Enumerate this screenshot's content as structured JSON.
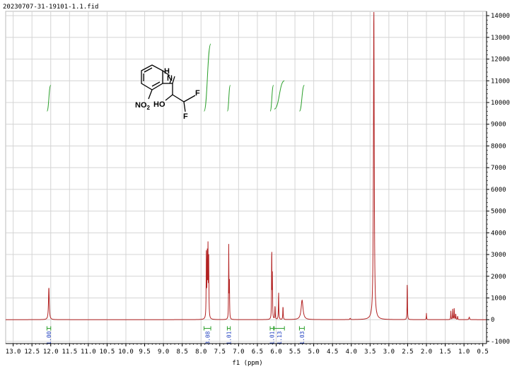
{
  "chart_data": {
    "type": "line",
    "title": "20230707-31-19101-1.1.fid",
    "xlabel": "f1 (ppm)",
    "ylabel": "",
    "xlim": [
      13.2,
      0.4
    ],
    "ylim": [
      -1100,
      14200
    ],
    "x_ticks": [
      "13.0",
      "12.5",
      "12.0",
      "11.5",
      "11.0",
      "10.5",
      "10.0",
      "9.5",
      "9.0",
      "8.5",
      "8.0",
      "7.5",
      "7.0",
      "6.5",
      "6.0",
      "5.5",
      "5.0",
      "4.5",
      "4.0",
      "3.5",
      "3.0",
      "2.5",
      "2.0",
      "1.5",
      "1.0",
      "0.5"
    ],
    "y_ticks": [
      "14000",
      "13000",
      "12000",
      "11000",
      "10000",
      "9000",
      "8000",
      "7000",
      "6000",
      "5000",
      "4000",
      "3000",
      "2000",
      "1000",
      "0",
      "-1000"
    ],
    "grid": true,
    "colors": {
      "spectrum": "#b22222",
      "integral": "#2ca02c",
      "integral_label": "#1f3fbf",
      "grid": "#d4d4d4"
    },
    "peaks": [
      {
        "ppm": 12.05,
        "height": 1500,
        "width": 0.012
      },
      {
        "ppm": 7.858,
        "height": 2950,
        "width": 0.006
      },
      {
        "ppm": 7.835,
        "height": 2850,
        "width": 0.006
      },
      {
        "ppm": 7.815,
        "height": 3150,
        "width": 0.006
      },
      {
        "ppm": 7.795,
        "height": 2700,
        "width": 0.006
      },
      {
        "ppm": 7.262,
        "height": 3450,
        "width": 0.005
      },
      {
        "ppm": 7.244,
        "height": 1700,
        "width": 0.005
      },
      {
        "ppm": 6.118,
        "height": 3550,
        "width": 0.005
      },
      {
        "ppm": 6.1,
        "height": 2000,
        "width": 0.005
      },
      {
        "ppm": 6.03,
        "height": 650,
        "width": 0.006
      },
      {
        "ppm": 5.935,
        "height": 1300,
        "width": 0.006
      },
      {
        "ppm": 5.818,
        "height": 650,
        "width": 0.006
      },
      {
        "ppm": 5.31,
        "height": 900,
        "width": 0.03
      },
      {
        "ppm": 4.03,
        "height": 60,
        "width": 0.01
      },
      {
        "ppm": 3.4,
        "height": 14500,
        "width": 0.012
      },
      {
        "ppm": 2.51,
        "height": 1850,
        "width": 0.005
      },
      {
        "ppm": 2.0,
        "height": 300,
        "width": 0.005
      },
      {
        "ppm": 1.35,
        "height": 400,
        "width": 0.005
      },
      {
        "ppm": 1.3,
        "height": 500,
        "width": 0.005
      },
      {
        "ppm": 1.26,
        "height": 560,
        "width": 0.005
      },
      {
        "ppm": 1.22,
        "height": 300,
        "width": 0.005
      },
      {
        "ppm": 1.17,
        "height": 180,
        "width": 0.005
      },
      {
        "ppm": 0.86,
        "height": 120,
        "width": 0.01
      }
    ],
    "integrals": [
      {
        "ppm_start": 12.1,
        "ppm_end": 12.0,
        "value": "1.00",
        "y_start": 9600,
        "y_end": 10800
      },
      {
        "ppm_start": 7.92,
        "ppm_end": 7.74,
        "value": "3.08",
        "y_start": 9600,
        "y_end": 12700
      },
      {
        "ppm_start": 7.3,
        "ppm_end": 7.22,
        "value": "1.01",
        "y_start": 9600,
        "y_end": 10800
      },
      {
        "ppm_start": 6.16,
        "ppm_end": 6.07,
        "value": "1.01",
        "y_start": 9600,
        "y_end": 10800
      },
      {
        "ppm_start": 6.05,
        "ppm_end": 5.78,
        "value": "1.13",
        "y_start": 9700,
        "y_end": 11000
      },
      {
        "ppm_start": 5.38,
        "ppm_end": 5.25,
        "value": "1.03",
        "y_start": 9600,
        "y_end": 10800
      }
    ]
  },
  "molecule": {
    "atoms": [
      {
        "label": "H",
        "role": "nh-h"
      },
      {
        "label": "N",
        "role": "nh-n"
      },
      {
        "label": "NO",
        "sub": "2",
        "role": "nitro"
      },
      {
        "label": "HO",
        "role": "hydroxyl"
      },
      {
        "label": "F",
        "role": "fluorine-1"
      },
      {
        "label": "F",
        "role": "fluorine-2"
      }
    ]
  }
}
